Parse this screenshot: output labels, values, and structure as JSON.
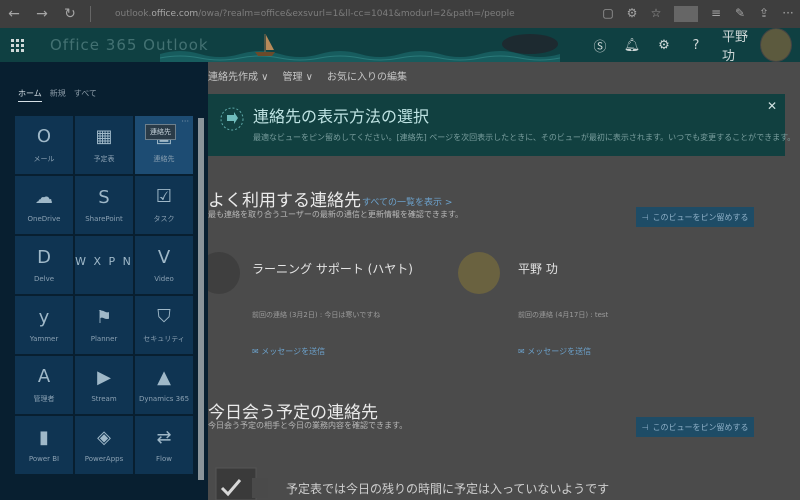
{
  "browser": {
    "url_prefix": "outlook.",
    "url_domain": "office.com",
    "url_rest": "/owa/?realm=office&exsvurl=1&ll-cc=1041&modurl=2&path=/people"
  },
  "header": {
    "brand": "Office 365   Outlook",
    "user_name": "平野 功"
  },
  "launcher": {
    "tabs": [
      "ホーム",
      "新規",
      "すべて"
    ],
    "apps": [
      {
        "label": "メール",
        "icon": "outlook-icon",
        "glyph": "O"
      },
      {
        "label": "予定表",
        "icon": "calendar-icon",
        "glyph": "▦"
      },
      {
        "label": "連絡先",
        "icon": "people-icon",
        "glyph": "▣",
        "tooltip": "連絡先",
        "more": "···"
      },
      {
        "label": "OneDrive",
        "icon": "onedrive-icon",
        "glyph": "☁"
      },
      {
        "label": "SharePoint",
        "icon": "sharepoint-icon",
        "glyph": "S"
      },
      {
        "label": "タスク",
        "icon": "tasks-icon",
        "glyph": "☑"
      },
      {
        "label": "Delve",
        "icon": "delve-icon",
        "glyph": "D"
      },
      {
        "label": "",
        "icon": "office-apps-icon",
        "glyph": "W X P N"
      },
      {
        "label": "Video",
        "icon": "video-icon",
        "glyph": "V"
      },
      {
        "label": "Yammer",
        "icon": "yammer-icon",
        "glyph": "y"
      },
      {
        "label": "Planner",
        "icon": "planner-icon",
        "glyph": "⚑"
      },
      {
        "label": "セキュリティ",
        "icon": "security-icon",
        "glyph": "⛉"
      },
      {
        "label": "管理者",
        "icon": "admin-icon",
        "glyph": "A"
      },
      {
        "label": "Stream",
        "icon": "stream-icon",
        "glyph": "▶"
      },
      {
        "label": "Dynamics 365",
        "icon": "dynamics-icon",
        "glyph": "▲"
      },
      {
        "label": "Power BI",
        "icon": "powerbi-icon",
        "glyph": "▮"
      },
      {
        "label": "PowerApps",
        "icon": "powerapps-icon",
        "glyph": "◈"
      },
      {
        "label": "Flow",
        "icon": "flow-icon",
        "glyph": "⇄"
      }
    ]
  },
  "commandbar": {
    "items": [
      "連絡先作成",
      "管理",
      "お気に入りの編集"
    ]
  },
  "banner": {
    "title": "連絡先の表示方法の選択",
    "description": "最適なビューをピン留めしてください。[連絡先] ページを次回表示したときに、そのビューが最初に表示されます。いつでも変更することができます。"
  },
  "frequent": {
    "title": "よく利用する連絡先",
    "link": "すべての一覧を表示 >",
    "subtitle": "最も連絡を取り合うユーザーの最新の通信と更新情報を確認できます。",
    "pin": "このビューをピン留めする",
    "contacts": [
      {
        "name": "ラーニング サポート (ハヤト)",
        "meta": "前回の連絡 (3月2日) : 今日は寒いですね",
        "action": "メッセージを送信"
      },
      {
        "name": "平野 功",
        "meta": "前回の連絡 (4月17日) : test",
        "action": "メッセージを送信"
      }
    ]
  },
  "today": {
    "title": "今日会う予定の連絡先",
    "subtitle": "今日会う予定の相手と今日の業務内容を確認できます。",
    "pin": "このビューをピン留めする",
    "empty": "予定表では今日の残りの時間に予定は入っていないようです"
  },
  "colors": {
    "launcher_bg": "#081f30",
    "tile_bg": "#0f3452",
    "header_bg": "#0f4042",
    "banner_bg": "#114040",
    "link": "#6ca2cc"
  }
}
